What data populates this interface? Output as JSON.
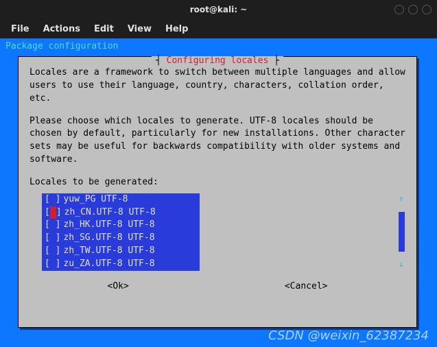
{
  "window": {
    "title": "root@kali: ~"
  },
  "menu": {
    "file": "File",
    "actions": "Actions",
    "edit": "Edit",
    "view": "View",
    "help": "Help"
  },
  "pkg_label": "Package configuration",
  "dialog": {
    "title": "Configuring locales",
    "para1": "Locales are a framework to switch between multiple languages and allow users to use their language, country, characters, collation order, etc.",
    "para2": "Please choose which locales to generate. UTF-8 locales should be chosen by default, particularly for new installations. Other character sets may be useful for backwards compatibility with older systems and software.",
    "prompt": "Locales to be generated:",
    "items": [
      {
        "checked": false,
        "cursor": false,
        "label": "yuw_PG UTF-8"
      },
      {
        "checked": false,
        "cursor": true,
        "label": "zh_CN.UTF-8 UTF-8"
      },
      {
        "checked": false,
        "cursor": false,
        "label": "zh_HK.UTF-8 UTF-8"
      },
      {
        "checked": false,
        "cursor": false,
        "label": "zh_SG.UTF-8 UTF-8"
      },
      {
        "checked": false,
        "cursor": false,
        "label": "zh_TW.UTF-8 UTF-8"
      },
      {
        "checked": false,
        "cursor": false,
        "label": "zu_ZA.UTF-8 UTF-8"
      }
    ],
    "ok": "<Ok>",
    "cancel": "<Cancel>"
  },
  "watermark": "CSDN @weixin_62387234"
}
